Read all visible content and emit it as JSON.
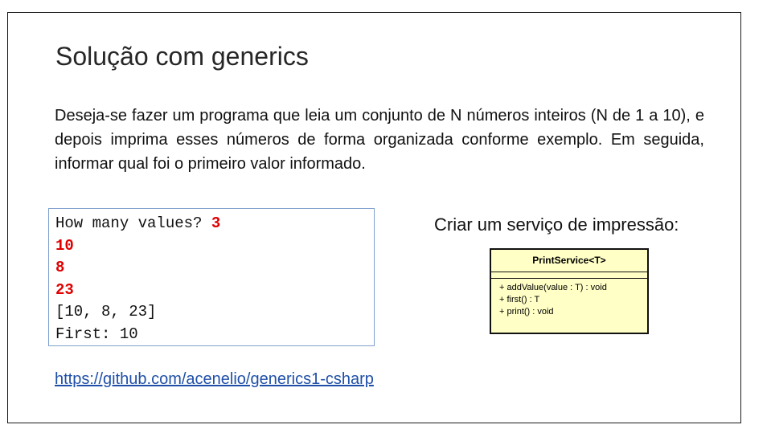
{
  "slide": {
    "title": "Solução com generics",
    "paragraph": "Deseja-se fazer um programa que leia um conjunto de N números inteiros (N de 1 a 10), e depois imprima esses números de forma organizada conforme exemplo. Em seguida, informar qual foi o primeiro valor informado.",
    "console": {
      "prompt": "How many values? ",
      "count_input": "3",
      "inputs": [
        "10",
        "8",
        "23"
      ],
      "list_output": "[10, 8, 23]",
      "first_output": "First: 10"
    },
    "service_caption": "Criar um serviço de impressão:",
    "uml": {
      "class_name": "PrintService<T>",
      "operations": [
        "+ addValue(value : T) : void",
        "+ first() : T",
        "+ print() : void"
      ]
    },
    "link": "https://github.com/acenelio/generics1-csharp"
  },
  "colors": {
    "input_highlight": "#e00000",
    "link": "#1f4fa8",
    "uml_fill": "#ffffc6",
    "console_border": "#7f9fce"
  }
}
